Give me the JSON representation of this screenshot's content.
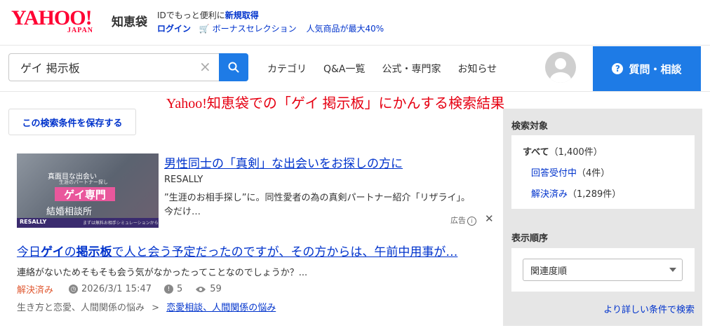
{
  "header": {
    "logo_text": "YAHOO!",
    "logo_sub": "JAPAN",
    "service_name": "知恵袋",
    "promo_prefix": "IDでもっと便利に",
    "promo_link": "新規取得",
    "login": "ログイン",
    "bonus": "ボーナスセレクション",
    "bonus_sub": "人気商品が最大40%"
  },
  "search": {
    "query": "ゲイ 掲示板",
    "clear_icon": "×"
  },
  "nav": {
    "items": [
      "カテゴリ",
      "Q&A一覧",
      "公式・専門家",
      "お知らせ"
    ]
  },
  "ask_button": "質問・相談",
  "result_title": "Yahoo!知恵袋での「ゲイ 掲示板」にかんする検索結果",
  "save_button": "この検索条件を保存する",
  "ad": {
    "image_text": {
      "line1": "真面目な出会い",
      "line2": "生涯のパートナー探し",
      "line3": "ゲイ専門",
      "line4": "結婚相談所",
      "brand": "RESALLY",
      "note": "まずは無料お相手シミュレーションから"
    },
    "title": "男性同士の「真剣」な出会いをお探しの方に",
    "brand": "RESALLY",
    "description": "”生涯のお相手探し”に。同性愛者の為の真剣パートナー紹介「リザライ」。今だけ…",
    "label": "広告"
  },
  "question": {
    "title_parts": [
      "今日",
      "ゲイ",
      "の",
      "掲示板",
      "で人と会う予定だったのですが、その方からは、午前中用事が…"
    ],
    "snippet": "連絡がないためそもそも会う気がなかったってことなのでしょうか？...",
    "status": "解決済み",
    "datetime": "2026/3/1 15:47",
    "answers": "5",
    "views": "59",
    "category_parent": "生き方と恋愛、人間関係の悩み",
    "category_sep": ">",
    "category_child": "恋愛相談、人間関係の悩み"
  },
  "sidebar": {
    "target_heading": "検索対象",
    "all_label": "すべて",
    "all_count": "（1,400件）",
    "open_label": "回答受付中",
    "open_count": "（4件）",
    "solved_label": "解決済み",
    "solved_count": "（1,289件）",
    "sort_heading": "表示順序",
    "sort_value": "関連度順",
    "advanced_link": "より詳しい条件で検索"
  },
  "colors": {
    "brand_red": "#ff0033",
    "link_blue": "#0033cc",
    "button_blue": "#1e7be6",
    "solved_orange": "#e05a33"
  }
}
